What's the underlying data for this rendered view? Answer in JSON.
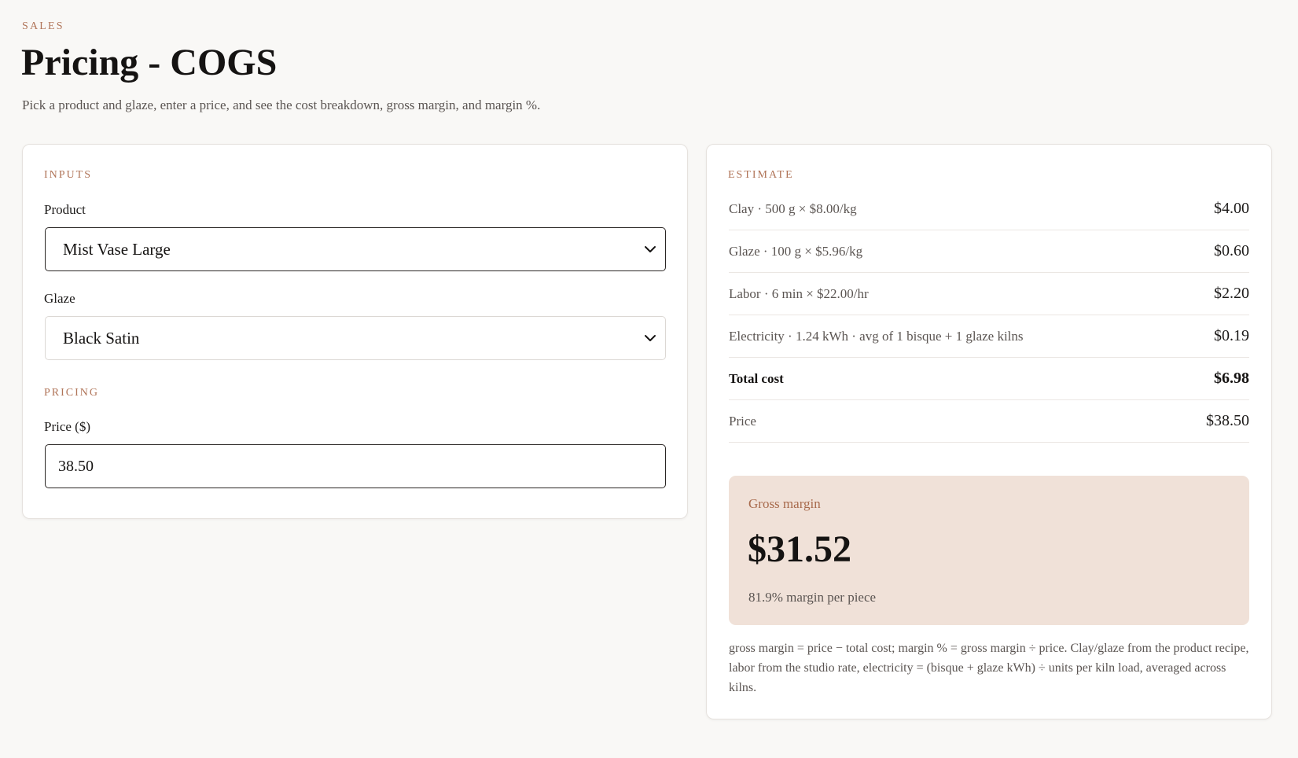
{
  "header": {
    "eyebrow": "SALES",
    "title": "Pricing - COGS",
    "subtitle": "Pick a product and glaze, enter a price, and see the cost breakdown, gross margin, and margin %."
  },
  "inputs": {
    "section_label": "INPUTS",
    "product_label": "Product",
    "product_value": "Mist Vase Large",
    "glaze_label": "Glaze",
    "glaze_value": "Black Satin",
    "pricing_label": "PRICING",
    "price_label": "Price ($)",
    "price_value": "38.50"
  },
  "estimate": {
    "section_label": "ESTIMATE",
    "rows": [
      {
        "label": "Clay · 500 g × $8.00/kg",
        "value": "$4.00"
      },
      {
        "label": "Glaze · 100 g × $5.96/kg",
        "value": "$0.60"
      },
      {
        "label": "Labor · 6 min × $22.00/hr",
        "value": "$2.20"
      },
      {
        "label": "Electricity · 1.24 kWh · avg of 1 bisque + 1 glaze kilns",
        "value": "$0.19"
      },
      {
        "label": "Total cost",
        "value": "$6.98"
      },
      {
        "label": "Price",
        "value": "$38.50"
      }
    ],
    "gross_margin_label": "Gross margin",
    "gross_margin_value": "$31.52",
    "margin_pct_text": "81.9% margin per piece",
    "footnote": "gross margin = price − total cost; margin % = gross margin ÷ price. Clay/glaze from the product recipe, labor from the studio rate, electricity = (bisque + glaze kWh) ÷ units per kiln load, averaged across kilns."
  },
  "icons": {
    "product_select": "chevron-down-icon",
    "glaze_select": "chevron-down-icon"
  },
  "colors": {
    "accent": "#b07458",
    "margin_bg": "#f0e1d8",
    "background": "#f9f8f6"
  }
}
